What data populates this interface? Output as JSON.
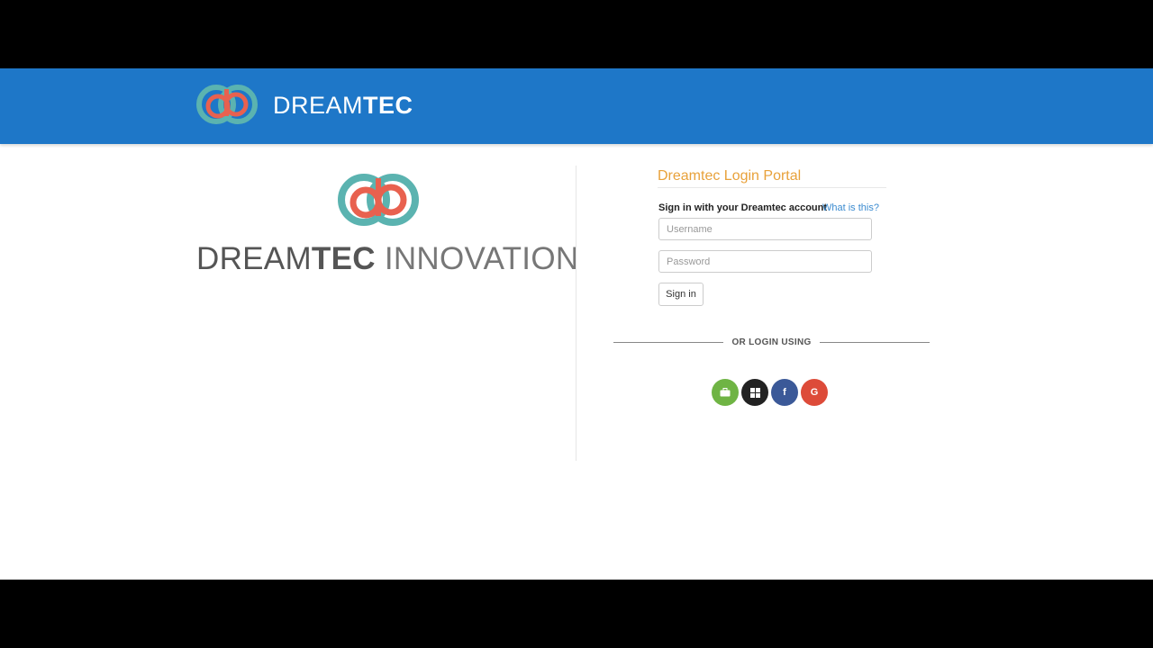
{
  "header": {
    "brand_light": "DREAM",
    "brand_bold": "TEC"
  },
  "hero": {
    "brand_light": "DREAM",
    "brand_bold": "TEC",
    "brand_suffix": " INNOVATION"
  },
  "login": {
    "title": "Dreamtec Login Portal",
    "signin_prompt": "Sign in with your Dreamtec account",
    "help_link": "What is this?",
    "username_placeholder": "Username",
    "password_placeholder": "Password",
    "signin_label": "Sign in",
    "divider_text": "OR LOGIN USING"
  },
  "social": [
    {
      "icon": "briefcase-icon",
      "color": "#6fb444"
    },
    {
      "icon": "windows-icon",
      "color": "#222222",
      "glyph": "⊞"
    },
    {
      "icon": "facebook-icon",
      "color": "#3b5998",
      "glyph": "f"
    },
    {
      "icon": "google-icon",
      "color": "#dd4b39",
      "glyph": "G"
    }
  ],
  "colors": {
    "header_bg": "#1e77c8",
    "title_accent": "#e8a13a",
    "logo_teal": "#5bb3b0",
    "logo_coral": "#e8614f"
  }
}
